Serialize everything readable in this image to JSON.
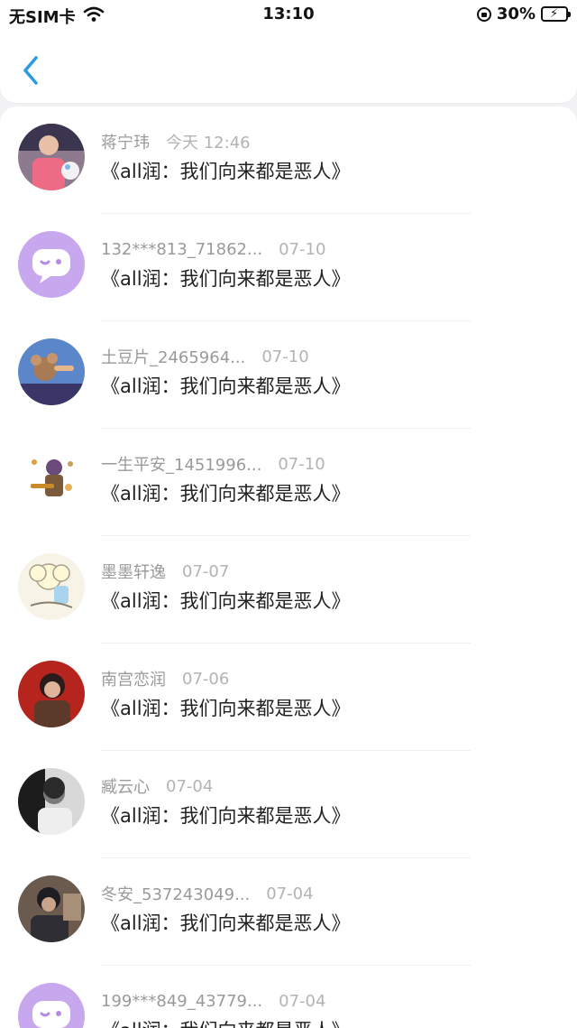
{
  "status_bar": {
    "carrier": "无SIM卡",
    "time": "13:10",
    "battery": "30%",
    "battery_level": 0.3,
    "icons": [
      "wifi-icon",
      "orientation-lock-icon",
      "battery-charging-icon"
    ]
  },
  "nav": {
    "back_icon": "chevron-left-icon",
    "accent_color": "#2a9be3"
  },
  "comments": [
    {
      "name": "蒋宁玮",
      "time": "今天 12:46",
      "message": "《all润：我们向来都是恶人》",
      "avatar": "photo-pink-shirt"
    },
    {
      "name": "132***813_71862...",
      "time": "07-10",
      "message": "《all润：我们向来都是恶人》",
      "avatar": "default-chat-bubble"
    },
    {
      "name": "土豆片_2465964...",
      "time": "07-10",
      "message": "《all润：我们向来都是恶人》",
      "avatar": "cartoon-mouse"
    },
    {
      "name": "一生平安_1451996...",
      "time": "07-10",
      "message": "《all润：我们向来都是恶人》",
      "avatar": "cartoon-figure"
    },
    {
      "name": "墨墨轩逸",
      "time": "07-07",
      "message": "《all润：我们向来都是恶人》",
      "avatar": "cartoon-sheep"
    },
    {
      "name": "南宫恋润",
      "time": "07-06",
      "message": "《all润：我们向来都是恶人》",
      "avatar": "photo-red-background"
    },
    {
      "name": "臧云心",
      "time": "07-04",
      "message": "《all润：我们向来都是恶人》",
      "avatar": "photo-black-white"
    },
    {
      "name": "冬安_537243049...",
      "time": "07-04",
      "message": "《all润：我们向来都是恶人》",
      "avatar": "photo-dark-cap"
    },
    {
      "name": "199***849_43779...",
      "time": "07-04",
      "message": "《all润：我们向来都是恶人》",
      "avatar": "default-chat-bubble"
    }
  ]
}
